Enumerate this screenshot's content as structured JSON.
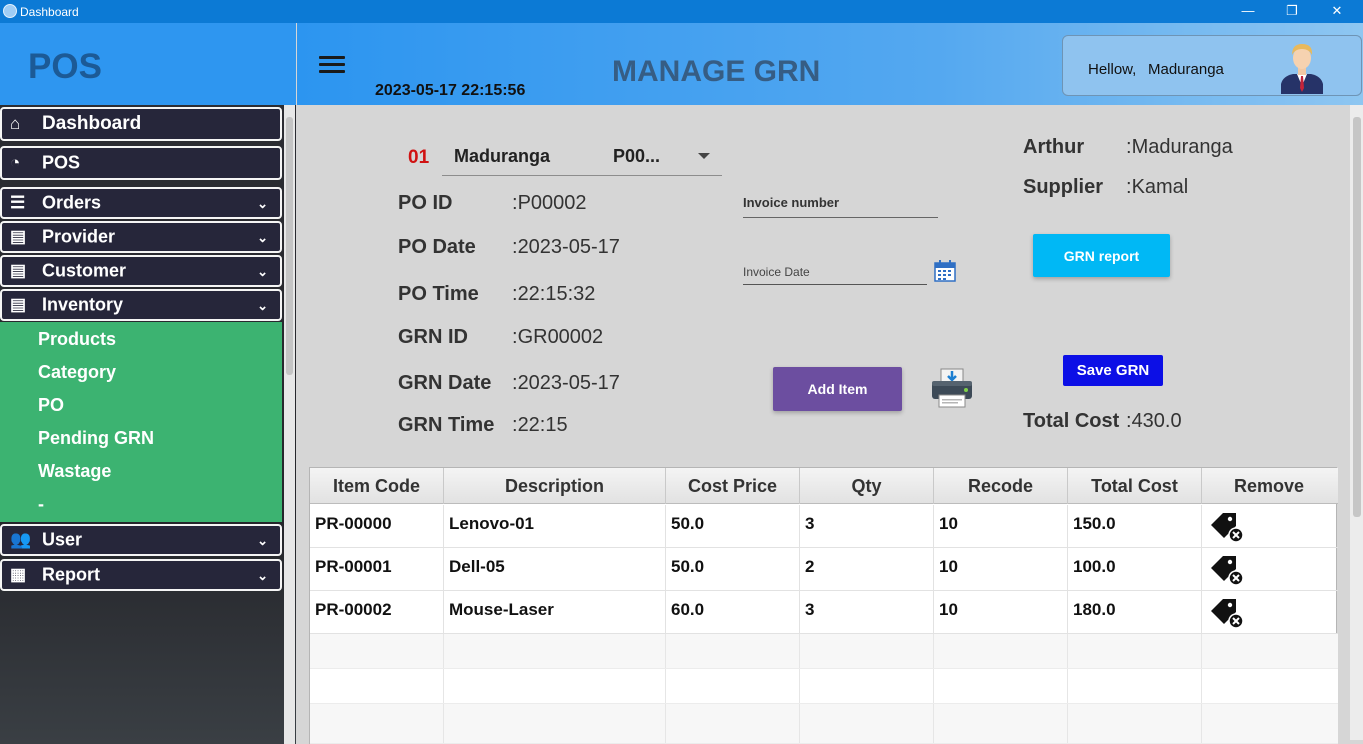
{
  "window": {
    "title": "Dashboard",
    "minimize": "—",
    "restore": "❐",
    "close": "✕"
  },
  "brand": {
    "logo": "POS"
  },
  "sidebar": {
    "items": [
      {
        "label": "Dashboard",
        "icon": "home-icon"
      },
      {
        "label": "POS",
        "icon": "gauge-icon"
      },
      {
        "label": "Orders",
        "icon": "list-icon"
      },
      {
        "label": "Provider",
        "icon": "wallet-icon"
      },
      {
        "label": "Customer",
        "icon": "wallet-icon"
      },
      {
        "label": "Inventory",
        "icon": "wallet-icon"
      },
      {
        "label": "User",
        "icon": "users-icon"
      },
      {
        "label": "Report",
        "icon": "report-icon"
      }
    ],
    "submenu": [
      "Products",
      "Category",
      "PO",
      "Pending GRN",
      "Wastage",
      "-"
    ]
  },
  "header": {
    "datetime": "2023-05-17 22:15:56",
    "title": "MANAGE GRN",
    "greeting": "Hellow,",
    "username": "Maduranga"
  },
  "form": {
    "po_number": "01",
    "po_combo": {
      "name": "Maduranga",
      "po": "P00..."
    },
    "fields": [
      {
        "label": "PO ID",
        "value": "P00002"
      },
      {
        "label": "PO Date",
        "value": "2023-05-17"
      },
      {
        "label": "PO Time",
        "value": "22:15:32"
      },
      {
        "label": "GRN ID",
        "value": "GR00002"
      },
      {
        "label": "GRN Date",
        "value": "2023-05-17"
      },
      {
        "label": "GRN Time",
        "value": "22:15"
      }
    ],
    "invoice_number_placeholder": "Invoice number",
    "invoice_date_placeholder": "Invoice Date",
    "add_item_label": "Add Item",
    "arthur_label": "Arthur",
    "arthur_value": "Maduranga",
    "supplier_label": "Supplier",
    "supplier_value": "Kamal",
    "grn_report_label": "GRN report",
    "save_grn_label": "Save GRN",
    "total_cost_label": "Total Cost",
    "total_cost_value": "430.0"
  },
  "table": {
    "columns": [
      "Item Code",
      "Description",
      "Cost Price",
      "Qty",
      "Recode",
      "Total Cost",
      "Remove"
    ],
    "rows": [
      {
        "code": "PR-00000",
        "desc": "Lenovo-01",
        "cost": "50.0",
        "qty": "3",
        "recode": "10",
        "total": "150.0"
      },
      {
        "code": "PR-00001",
        "desc": "Dell-05",
        "cost": "50.0",
        "qty": "2",
        "recode": "10",
        "total": "100.0"
      },
      {
        "code": "PR-00002",
        "desc": "Mouse-Laser",
        "cost": "60.0",
        "qty": "3",
        "recode": "10",
        "total": "180.0"
      }
    ]
  }
}
